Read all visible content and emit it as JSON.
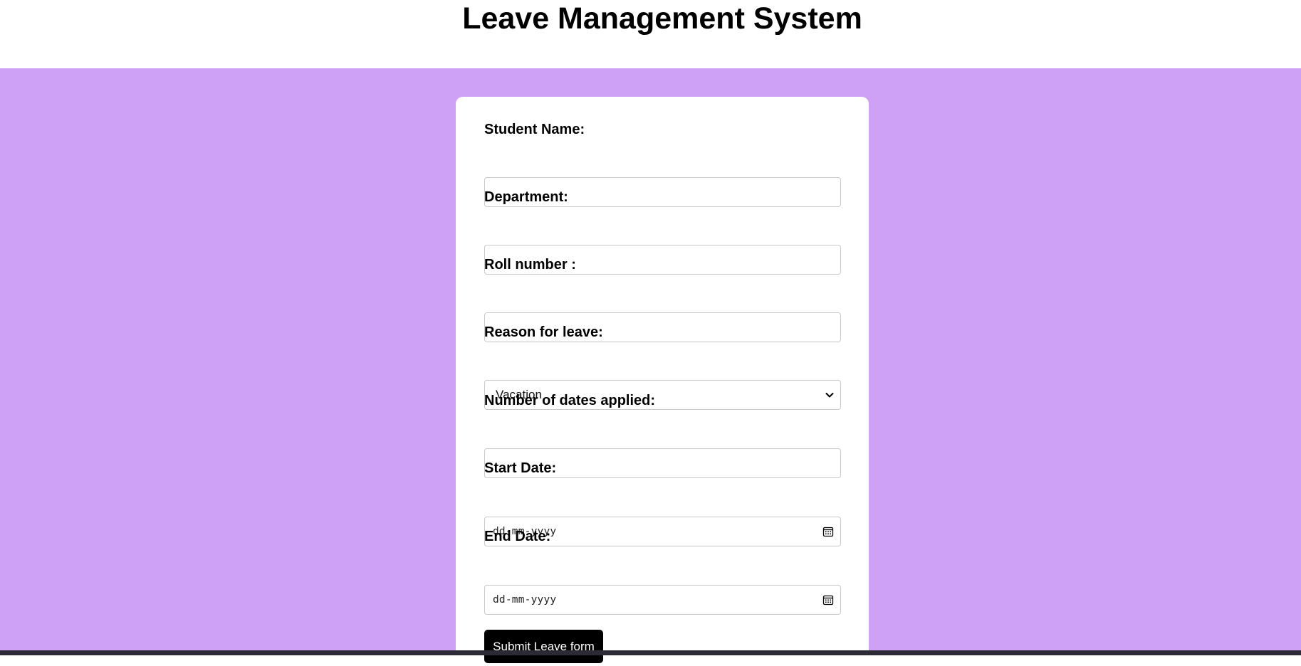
{
  "page": {
    "title": "Leave Management System"
  },
  "form": {
    "student_name": {
      "label": "Student Name:",
      "value": ""
    },
    "department": {
      "label": "Department:",
      "value": ""
    },
    "roll_number": {
      "label": "Roll number :",
      "value": ""
    },
    "reason": {
      "label": "Reason for leave:",
      "selected": "Vacation",
      "icon": "chevron-down-icon"
    },
    "num_dates": {
      "label": "Number of dates applied:",
      "value": ""
    },
    "start_date": {
      "label": "Start Date:",
      "placeholder": "dd-mm-yyyy",
      "icon": "calendar-icon"
    },
    "end_date": {
      "label": "End Date:",
      "placeholder": "dd-mm-yyyy",
      "icon": "calendar-icon"
    },
    "submit_label": "Submit Leave form"
  },
  "colors": {
    "background": "#cfa1f6",
    "card": "#ffffff",
    "button": "#000000",
    "button_text": "#ffffff"
  }
}
